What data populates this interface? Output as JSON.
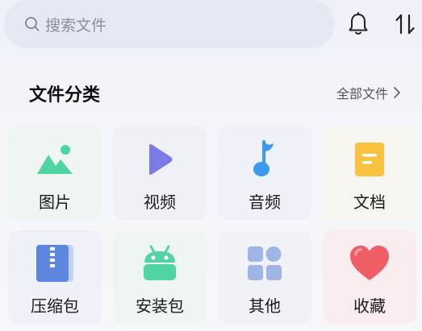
{
  "search": {
    "placeholder": "搜索文件"
  },
  "section": {
    "title": "文件分类",
    "all_label": "全部文件"
  },
  "categories": [
    {
      "label": "图片",
      "icon": "image-icon",
      "bg": "#eef5f3"
    },
    {
      "label": "视频",
      "icon": "video-play-icon",
      "bg": "#f0f0f7"
    },
    {
      "label": "音频",
      "icon": "music-note-icon",
      "bg": "#eef2f8"
    },
    {
      "label": "文档",
      "icon": "document-icon",
      "bg": "#f7f5ef"
    },
    {
      "label": "压缩包",
      "icon": "zip-icon",
      "bg": "#eef1f8"
    },
    {
      "label": "安装包",
      "icon": "android-icon",
      "bg": "#eef5f3"
    },
    {
      "label": "其他",
      "icon": "grid-icon",
      "bg": "#f0f2f7"
    },
    {
      "label": "收藏",
      "icon": "heart-icon",
      "bg": "#f8ecee"
    }
  ],
  "colors": {
    "green": "#4fd4a2",
    "purple": "#7b7be8",
    "blue": "#3a9af0",
    "yellow": "#f7c33e",
    "red": "#ef5e64",
    "gray_blue": "#9fb5e6"
  }
}
